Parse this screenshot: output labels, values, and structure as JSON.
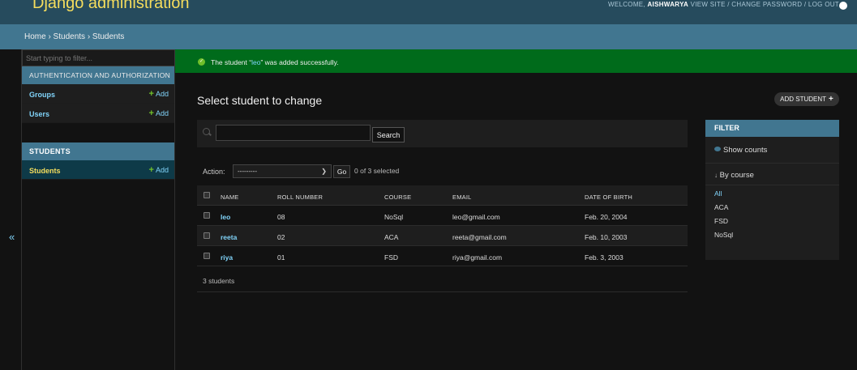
{
  "header": {
    "site_title": "Django administration",
    "welcome": "WELCOME,",
    "username": "AISHWARYA",
    "user_links": "VIEW SITE / CHANGE PASSWORD / LOG OUT"
  },
  "breadcrumbs": "Home › Students › Students",
  "sidebar": {
    "filter_placeholder": "Start typing to filter...",
    "collapse_icon": "«",
    "modules": [
      {
        "caption": "AUTHENTICATION AND AUTHORIZATION",
        "models": [
          {
            "name": "Groups",
            "add_label": "Add"
          },
          {
            "name": "Users",
            "add_label": "Add"
          }
        ]
      },
      {
        "caption": "STUDENTS",
        "models": [
          {
            "name": "Students",
            "add_label": "Add",
            "current": true
          }
        ]
      }
    ]
  },
  "message": {
    "prefix": "The student “",
    "object_link": "leo",
    "suffix": "” was added successfully."
  },
  "content": {
    "title": "Select student to change",
    "add_button": "ADD STUDENT",
    "search_button": "Search",
    "search_value": ""
  },
  "actions": {
    "label": "Action:",
    "selected_option": "---------",
    "go_button": "Go",
    "counter": "0 of 3 selected"
  },
  "table": {
    "columns": [
      "NAME",
      "ROLL NUMBER",
      "COURSE",
      "EMAIL",
      "DATE OF BIRTH"
    ],
    "rows": [
      {
        "name": "leo",
        "roll": "08",
        "course": "NoSql",
        "email": "leo@gmail.com",
        "dob": "Feb. 20, 2004"
      },
      {
        "name": "reeta",
        "roll": "02",
        "course": "ACA",
        "email": "reeta@gmail.com",
        "dob": "Feb. 10, 2003"
      },
      {
        "name": "riya",
        "roll": "01",
        "course": "FSD",
        "email": "riya@gmail.com",
        "dob": "Feb. 3, 2003"
      }
    ],
    "paginator": "3 students"
  },
  "filter": {
    "title": "FILTER",
    "show_counts": "Show counts",
    "heading_arrow": "↓",
    "heading": "By course",
    "options": [
      "All",
      "ACA",
      "FSD",
      "NoSql"
    ]
  },
  "colors": {
    "header_bg": "#264b5d",
    "breadcrumb_bg": "#417690",
    "success_bg": "#006b1b",
    "link": "#81d4fa",
    "accent_yellow": "#f5dd5d",
    "add_green": "#70bf2b"
  }
}
